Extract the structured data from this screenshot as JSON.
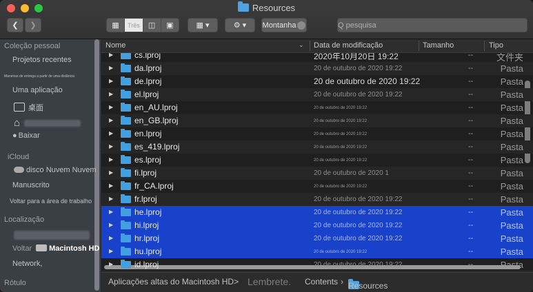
{
  "window": {
    "title": "Resources"
  },
  "toolbar": {
    "view_label": "Três",
    "tag_label": "Montanha",
    "search_placeholder": "Q pesquisa"
  },
  "sidebar": {
    "items": [
      {
        "label": "Coleção pessoal",
        "kind": "head"
      },
      {
        "label": "Projetos recentes",
        "kind": "item"
      },
      {
        "label": "Maneiras de entrega a partir de uma distância",
        "kind": "tiny"
      },
      {
        "label": "Uma aplicação",
        "kind": "item"
      },
      {
        "label": "桌面",
        "kind": "item",
        "icon": "desktop-icon"
      },
      {
        "label": "",
        "kind": "item",
        "icon": "home-icon"
      },
      {
        "label": "Baixar",
        "kind": "item"
      },
      {
        "label": "iCloud",
        "kind": "head"
      },
      {
        "label": "disco Nuvem Nuvem",
        "kind": "item",
        "icon": "cloud-icon"
      },
      {
        "label": "Manuscrito",
        "kind": "item"
      },
      {
        "label": "Voltar para a área de trabalho",
        "kind": "small"
      },
      {
        "label": "Localização",
        "kind": "head"
      },
      {
        "label": "Macintosh HD",
        "kind": "item",
        "icon": "disk-icon",
        "prefix": "Voltar"
      },
      {
        "label": "Network,",
        "kind": "item"
      },
      {
        "label": "Rótulo",
        "kind": "head"
      }
    ]
  },
  "columns": {
    "name": "Nome",
    "date": "Data de modificação",
    "size": "Tamanho",
    "kind": "Tipo"
  },
  "files": [
    {
      "name": "cs.lproj",
      "date": "2020年10月20日 19:22",
      "size": "--",
      "kind": "文件夹",
      "style": "big"
    },
    {
      "name": "da.lproj",
      "date": "20 de outubro de 2020 19:22",
      "size": "--",
      "kind": "Pasta",
      "style": "normal"
    },
    {
      "name": "de.lproj",
      "date": "20 de outubro de 2020 19:22",
      "size": "--",
      "kind": "Pasta",
      "style": "big"
    },
    {
      "name": "el.lproj",
      "date": "20 de outubro de 2020 19:22",
      "size": "--",
      "kind": "Pasta",
      "style": "normal"
    },
    {
      "name": "en_AU.lproj",
      "date": "20 de outubro de 2020 19:22",
      "size": "--",
      "kind": "Pasta",
      "style": "tiny"
    },
    {
      "name": "en_GB.lproj",
      "date": "20 de outubro de 2020 19:22",
      "size": "--",
      "kind": "Pasta",
      "style": "tiny"
    },
    {
      "name": "en.lproj",
      "date": "20 de outubro de 2020 19:22",
      "size": "--",
      "kind": "Pasta",
      "style": "tiny"
    },
    {
      "name": "es_419.lproj",
      "date": "20 de outubro de 2020 19:22",
      "size": "--",
      "kind": "Pasta",
      "style": "tiny"
    },
    {
      "name": "es.lproj",
      "date": "20 de outubro de 2020 19:22",
      "size": "--",
      "kind": "Pasta",
      "style": "tiny"
    },
    {
      "name": "fi.lproj",
      "date": "20 de outubro de 2020 1",
      "size": "--",
      "kind": "Pasta",
      "style": "normal"
    },
    {
      "name": "fr_CA.lproj",
      "date": "20 de outubro de 2020 19:22",
      "size": "--",
      "kind": "Pasta",
      "style": "tiny"
    },
    {
      "name": "fr.lproj",
      "date": "20 de outubro de 2020 19:22",
      "size": "--",
      "kind": "Pasta",
      "style": "normal"
    },
    {
      "name": "he.lproj",
      "date": "20 de outubro de 2020 19:22",
      "size": "--",
      "kind": "Pasta",
      "style": "normal",
      "selected": true
    },
    {
      "name": "hi.lproj",
      "date": "20 de outubro de 2020 19:22",
      "size": "--",
      "kind": "Pasta",
      "style": "normal",
      "selected": true
    },
    {
      "name": "hr.lproj",
      "date": "20 de outubro de 2020 19:22",
      "size": "--",
      "kind": "Pasta",
      "style": "normal",
      "selected": true
    },
    {
      "name": "hu.lproj",
      "date": "20 de outubro de 2020 19:22",
      "size": "--",
      "kind": "Pasta",
      "style": "tiny",
      "selected": true
    },
    {
      "name": "id.lproj",
      "date": "20 de outubro de 2020 19:22",
      "size": "--",
      "kind": "Pasta",
      "style": "normal"
    }
  ],
  "pathbar": {
    "root": "Aplicações altas do Macintosh HD>",
    "middle": "Lembrete.",
    "contents": "Contents",
    "sep": "›",
    "current": "Resources"
  },
  "colors": {
    "selection": "#1742c9",
    "folder": "#42a0e0"
  }
}
